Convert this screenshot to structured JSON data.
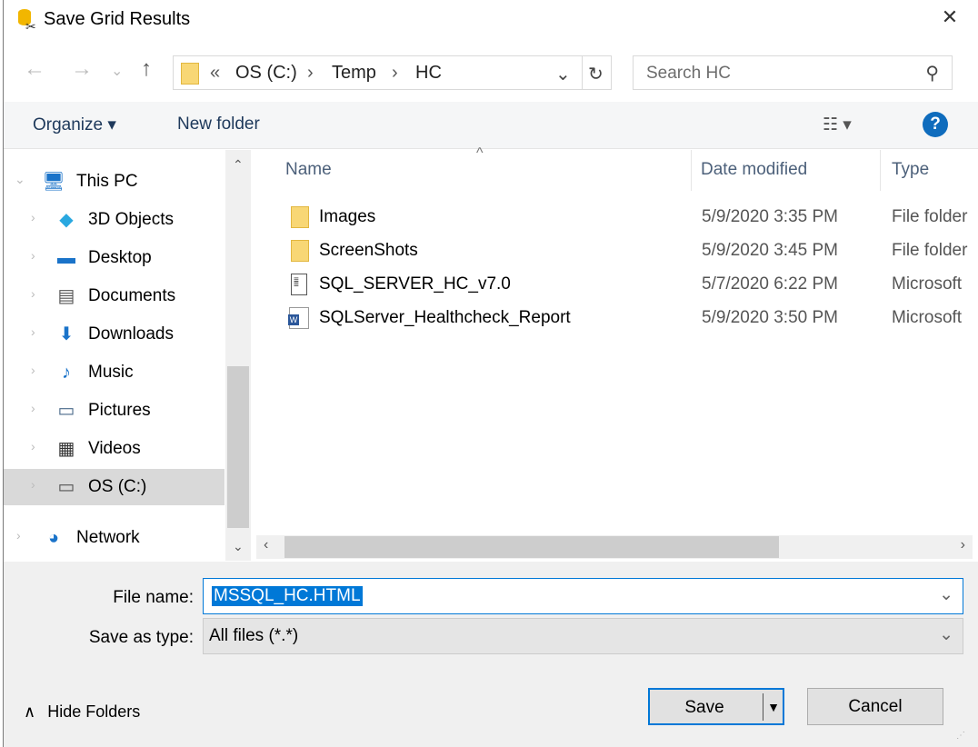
{
  "window": {
    "title": "Save Grid Results",
    "close": "✕"
  },
  "nav": {
    "back": "←",
    "forward": "→",
    "recent": "⌄",
    "up": "↑"
  },
  "address": {
    "prefix": "«",
    "segments": [
      "OS (C:)",
      "Temp",
      "HC"
    ],
    "sep": "›",
    "refresh": "↻",
    "dropdown": "⌄"
  },
  "search": {
    "placeholder": "Search HC"
  },
  "toolbar": {
    "organize": "Organize ▾",
    "new_folder": "New folder",
    "view": "☷ ▾",
    "help": "?"
  },
  "tree": {
    "root": {
      "label": "This PC",
      "icon": "computer-icon"
    },
    "items": [
      {
        "label": "3D Objects",
        "icon": "cube-icon",
        "glyph": "◆",
        "color": "#29a8e0"
      },
      {
        "label": "Desktop",
        "icon": "desktop-icon",
        "glyph": "▬",
        "color": "#1a73c9"
      },
      {
        "label": "Documents",
        "icon": "document-icon",
        "glyph": "▤",
        "color": "#555"
      },
      {
        "label": "Downloads",
        "icon": "download-icon",
        "glyph": "⬇",
        "color": "#1a73c9"
      },
      {
        "label": "Music",
        "icon": "music-icon",
        "glyph": "♪",
        "color": "#1a73c9"
      },
      {
        "label": "Pictures",
        "icon": "pictures-icon",
        "glyph": "▭",
        "color": "#4a6a8a"
      },
      {
        "label": "Videos",
        "icon": "video-icon",
        "glyph": "▦",
        "color": "#333"
      },
      {
        "label": "OS (C:)",
        "icon": "drive-icon",
        "glyph": "▭",
        "color": "#555",
        "selected": true
      }
    ],
    "network": {
      "label": "Network",
      "icon": "network-icon"
    }
  },
  "columns": {
    "name": "Name",
    "date": "Date modified",
    "type": "Type"
  },
  "files": [
    {
      "name": "Images",
      "date": "5/9/2020 3:35 PM",
      "type": "File folder",
      "icon": "folder-icon"
    },
    {
      "name": "ScreenShots",
      "date": "5/9/2020 3:45 PM",
      "type": "File folder",
      "icon": "folder-icon"
    },
    {
      "name": "SQL_SERVER_HC_v7.0",
      "date": "5/7/2020 6:22 PM",
      "type": "Microsoft",
      "icon": "script-file-icon"
    },
    {
      "name": "SQLServer_Healthcheck_Report",
      "date": "5/9/2020 3:50 PM",
      "type": "Microsoft",
      "icon": "word-doc-icon"
    }
  ],
  "form": {
    "file_name_label": "File name:",
    "file_name_value": "MSSQL_HC.HTML",
    "type_label": "Save as type:",
    "type_value": "All files (*.*)"
  },
  "footer": {
    "hide_folders": "Hide Folders",
    "save": "Save",
    "cancel": "Cancel"
  },
  "colors": {
    "accent": "#0078d7",
    "selection": "#0078d7",
    "folder": "#f8d775"
  }
}
